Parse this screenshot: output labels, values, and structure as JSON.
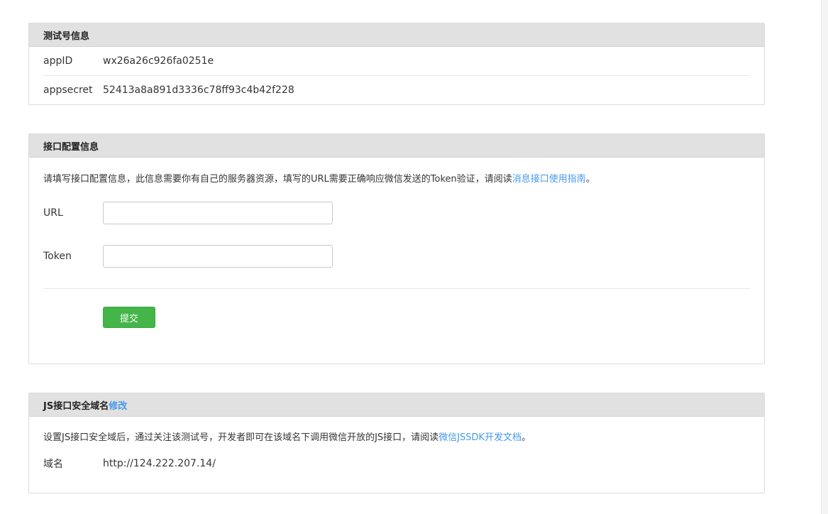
{
  "test_account": {
    "title": "测试号信息",
    "rows": [
      {
        "key": "appID",
        "value": "wx26a26c926fa0251e"
      },
      {
        "key": "appsecret",
        "value": "52413a8a891d3336c78ff93c4b42f228"
      }
    ]
  },
  "interface_config": {
    "title": "接口配置信息",
    "desc_prefix": "请填写接口配置信息，此信息需要你有自己的服务器资源，填写的URL需要正确响应微信发送的Token验证，请阅读",
    "desc_link": "消息接口使用指南",
    "desc_suffix": "。",
    "url_label": "URL",
    "url_value": "",
    "token_label": "Token",
    "token_value": "",
    "submit_label": "提交"
  },
  "js_domain": {
    "title": "JS接口安全域名",
    "edit_link": "修改",
    "desc_prefix": "设置JS接口安全域后，通过关注该测试号，开发者即可在该域名下调用微信开放的JS接口，请阅读",
    "desc_link": "微信JSSDK开发文档",
    "desc_suffix": "。",
    "domain_label": "域名",
    "domain_value": "http://124.222.207.14/"
  },
  "colors": {
    "header_bg": "#e1e1e1",
    "link": "#459ae9",
    "submit": "#44b549"
  }
}
